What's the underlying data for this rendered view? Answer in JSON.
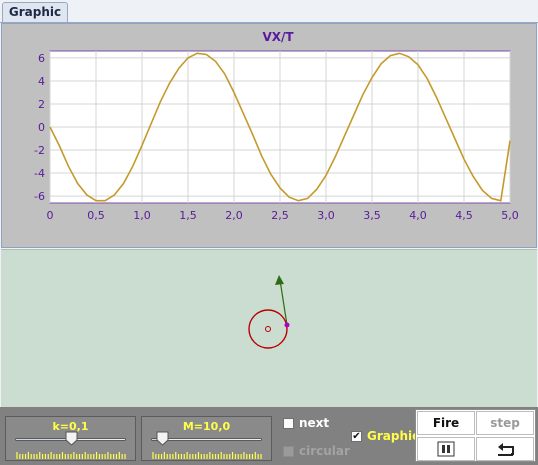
{
  "tabs": [
    {
      "label": "Graphic"
    }
  ],
  "chart_data": {
    "type": "line",
    "title": "VX/T",
    "xlabel": "",
    "ylabel": "",
    "xlim": [
      0,
      5.0
    ],
    "ylim": [
      -6.6,
      6.6
    ],
    "x_ticks": [
      "0",
      "0,5",
      "1,0",
      "1,5",
      "2,0",
      "2,5",
      "3,0",
      "3,5",
      "4,0",
      "4,5",
      "5,0"
    ],
    "y_ticks": [
      "6",
      "4",
      "2",
      "0",
      "-2",
      "-4",
      "-6"
    ],
    "grid": true,
    "series": [
      {
        "color": "#c49a2b",
        "x": [
          0,
          0.1,
          0.2,
          0.3,
          0.4,
          0.5,
          0.6,
          0.7,
          0.8,
          0.9,
          1.0,
          1.1,
          1.2,
          1.3,
          1.4,
          1.5,
          1.6,
          1.7,
          1.8,
          1.9,
          2.0,
          2.1,
          2.2,
          2.3,
          2.4,
          2.5,
          2.6,
          2.7,
          2.8,
          2.9,
          3.0,
          3.1,
          3.2,
          3.3,
          3.4,
          3.5,
          3.6,
          3.7,
          3.8,
          3.9,
          4.0,
          4.1,
          4.2,
          4.3,
          4.4,
          4.5,
          4.6,
          4.7,
          4.8,
          4.9,
          5.0
        ],
        "y": [
          0,
          -1.6,
          -3.4,
          -4.9,
          -5.9,
          -6.4,
          -6.4,
          -5.9,
          -4.9,
          -3.4,
          -1.6,
          0.3,
          2.2,
          3.8,
          5.1,
          6.0,
          6.4,
          6.3,
          5.7,
          4.6,
          3.0,
          1.2,
          -0.6,
          -2.5,
          -4.1,
          -5.3,
          -6.1,
          -6.4,
          -6.2,
          -5.4,
          -4.2,
          -2.6,
          -0.8,
          1.0,
          2.8,
          4.3,
          5.5,
          6.2,
          6.4,
          6.1,
          5.4,
          4.2,
          2.6,
          0.8,
          -1.0,
          -2.8,
          -4.3,
          -5.5,
          -6.2,
          -6.4,
          -1.2
        ]
      }
    ]
  },
  "controls": {
    "k_label": "k=0,1",
    "k_value": 0.5,
    "m_label": "M=10,0",
    "m_value": 0.1,
    "next_label": "next",
    "next_checked": false,
    "circular_label": "circular",
    "graphic_label": "Graphic",
    "graphic_checked": true,
    "fire_label": "Fire",
    "step_label": "step",
    "pause_icon": "pause-icon",
    "reset_icon": "undo-arrow-icon"
  },
  "colors": {
    "label_yellow": "#ffff4a",
    "curve": "#c49a2b",
    "axis_text": "#5a1a9a",
    "ball": "#b80000",
    "velocity_arrow": "#2e6b12"
  }
}
